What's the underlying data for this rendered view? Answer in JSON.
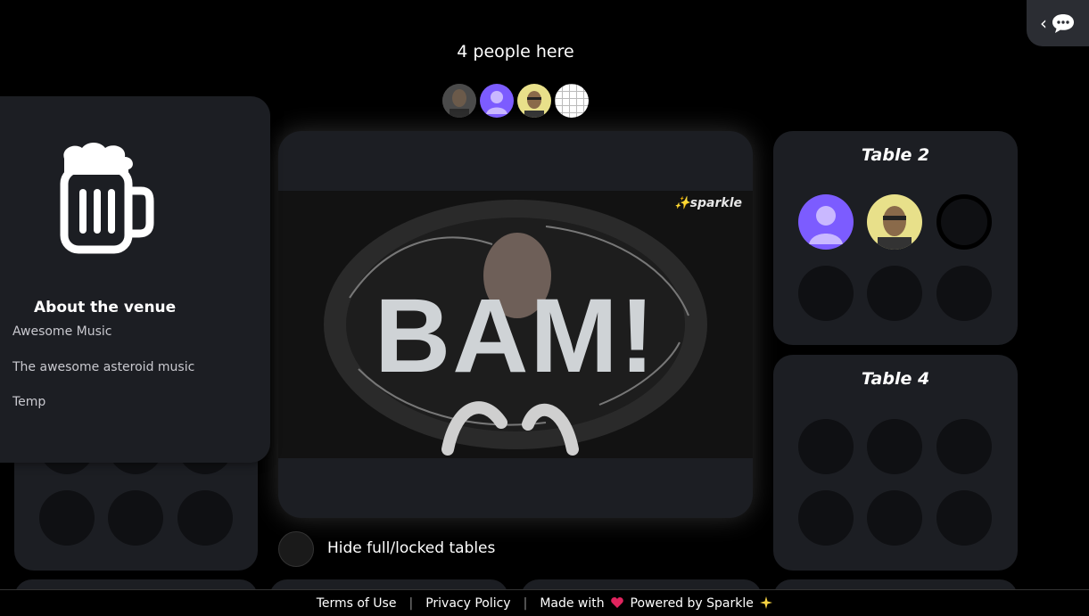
{
  "header": {
    "people_count": "4 people here"
  },
  "venue": {
    "about_title": "About the venue",
    "lines": [
      "Awesome Music",
      "The awesome asteroid music",
      "Temp"
    ]
  },
  "tables": [
    {
      "name": "Table 2"
    },
    {
      "name": "Table 4"
    }
  ],
  "stage": {
    "video_text": "BAM!",
    "watermark": "✨sparkle"
  },
  "controls": {
    "hide_tables_label": "Hide full/locked tables"
  },
  "footer": {
    "terms": "Terms of Use",
    "privacy": "Privacy Policy",
    "made_with": "Made with",
    "powered_by": "Powered by Sparkle",
    "separator": "|"
  },
  "colors": {
    "accent_purple": "#7c5cff",
    "card_bg": "#1c1e23",
    "heart": "#e0245e"
  },
  "icons": [
    "chat-icon",
    "chevron-left-icon",
    "beer-mug-icon",
    "heart-icon",
    "sparkle-icon"
  ]
}
